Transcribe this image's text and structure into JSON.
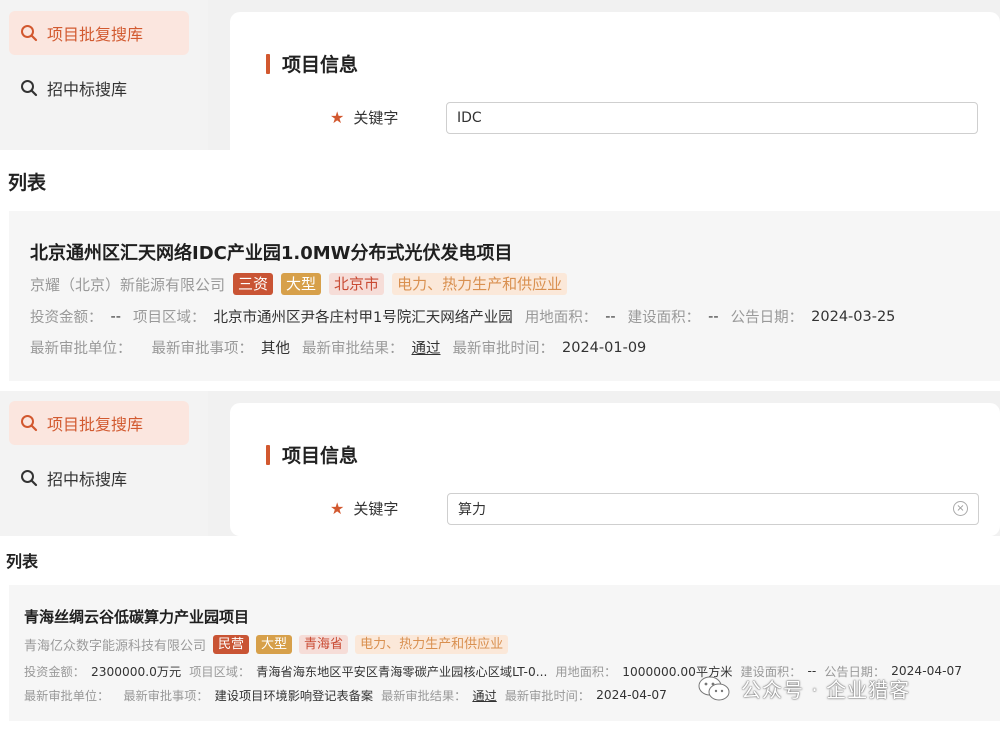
{
  "panels": [
    {
      "nav": {
        "active_label": "项目批复搜库",
        "other_label": "招中标搜库"
      },
      "section_title": "项目信息",
      "keyword_label": "关键字",
      "keyword_value": "IDC",
      "list_heading": "列表",
      "result": {
        "title": "北京通州区汇天网络IDC产业园1.0MW分布式光伏发电项目",
        "company": "京耀（北京）新能源有限公司",
        "tags": [
          "三资",
          "大型",
          "北京市",
          "电力、热力生产和供应业"
        ],
        "meta1": [
          {
            "k": "投资金额：",
            "v": "--"
          },
          {
            "k": "项目区域：",
            "v": "北京市通州区尹各庄村甲1号院汇天网络产业园"
          },
          {
            "k": "用地面积：",
            "v": "--"
          },
          {
            "k": "建设面积：",
            "v": "--"
          },
          {
            "k": "公告日期：",
            "v": "2024-03-25"
          }
        ],
        "meta2": [
          {
            "k": "最新审批单位：",
            "v": ""
          },
          {
            "k": "最新审批事项：",
            "v": "其他"
          },
          {
            "k": "最新审批结果：",
            "v": "通过"
          },
          {
            "k": "最新审批时间：",
            "v": "2024-01-09"
          }
        ]
      }
    },
    {
      "nav": {
        "active_label": "项目批复搜库",
        "other_label": "招中标搜库"
      },
      "section_title": "项目信息",
      "keyword_label": "关键字",
      "keyword_value": "算力",
      "list_heading": "列表",
      "result": {
        "title": "青海丝绸云谷低碳算力产业园项目",
        "company": "青海亿众数字能源科技有限公司",
        "tags": [
          "民营",
          "大型",
          "青海省",
          "电力、热力生产和供应业"
        ],
        "meta1": [
          {
            "k": "投资金额：",
            "v": "2300000.0万元"
          },
          {
            "k": "项目区域：",
            "v": "青海省海东地区平安区青海零碳产业园核心区域LT-0..."
          },
          {
            "k": "用地面积：",
            "v": "1000000.00平方米"
          },
          {
            "k": "建设面积：",
            "v": "--"
          },
          {
            "k": "公告日期：",
            "v": "2024-04-07"
          }
        ],
        "meta2": [
          {
            "k": "最新审批单位：",
            "v": ""
          },
          {
            "k": "最新审批事项：",
            "v": "建设项目环境影响登记表备案"
          },
          {
            "k": "最新审批结果：",
            "v": "通过"
          },
          {
            "k": "最新审批时间：",
            "v": "2024-04-07"
          }
        ]
      }
    }
  ],
  "watermark": {
    "text": "公众号 · 企业猎客",
    "icon": "wechat-icon"
  },
  "icons": {
    "search": "search-icon",
    "required": "star-icon",
    "clear": "clear-icon"
  },
  "colors": {
    "accent": "#d2582f",
    "nav_active_bg": "#fbe6df"
  }
}
